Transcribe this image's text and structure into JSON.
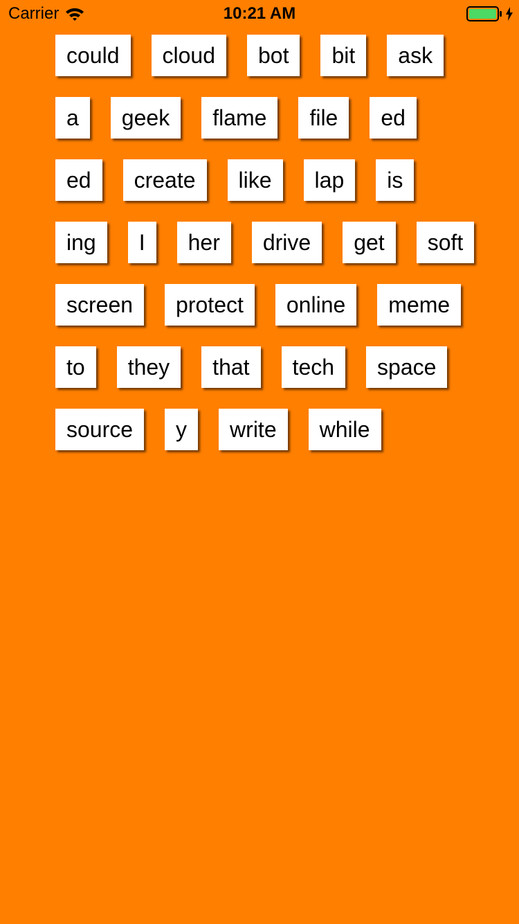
{
  "status_bar": {
    "carrier": "Carrier",
    "time": "10:21 AM",
    "wifi_icon": "wifi-icon",
    "battery_icon": "battery-charging-icon",
    "battery_color": "#4CD964"
  },
  "background_color": "#FF7F00",
  "tile_color": "#FFFFFF",
  "word_rows": [
    [
      "could",
      "cloud",
      "bot",
      "bit",
      "ask"
    ],
    [
      "a",
      "geek",
      "flame",
      "file",
      "ed"
    ],
    [
      "ed",
      "create",
      "like",
      "lap",
      "is"
    ],
    [
      "ing",
      "I",
      "her",
      "drive",
      "get",
      "soft"
    ],
    [
      "screen",
      "protect",
      "online",
      "meme"
    ],
    [
      "to",
      "they",
      "that",
      "tech",
      "space"
    ],
    [
      "source",
      "y",
      "write",
      "while"
    ]
  ]
}
